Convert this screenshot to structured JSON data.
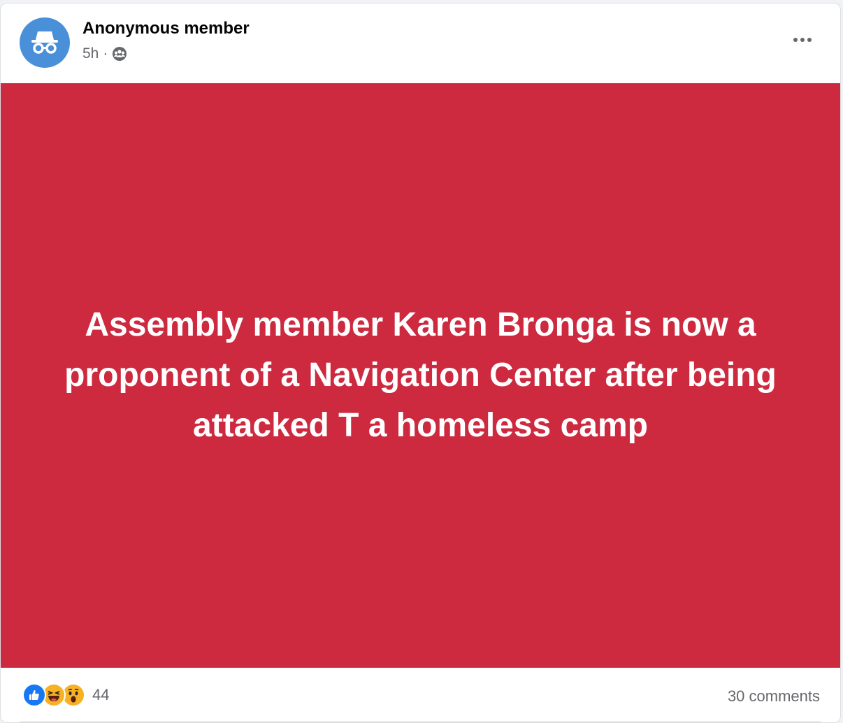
{
  "post": {
    "author": "Anonymous member",
    "time": "5h",
    "separator": "·",
    "visibility_icon": "group-icon",
    "avatar_icon": "incognito-icon",
    "more_icon": "more-options-icon"
  },
  "content": {
    "text": "Assembly member Karen Bronga is now a proponent of a Navigation Center after being attacked T a homeless camp",
    "background_color": "#cd2a40",
    "text_color": "#ffffff"
  },
  "engagement": {
    "reaction_icons": [
      "like-icon",
      "haha-icon",
      "wow-icon"
    ],
    "reaction_count": "44",
    "comments": "30 comments"
  }
}
